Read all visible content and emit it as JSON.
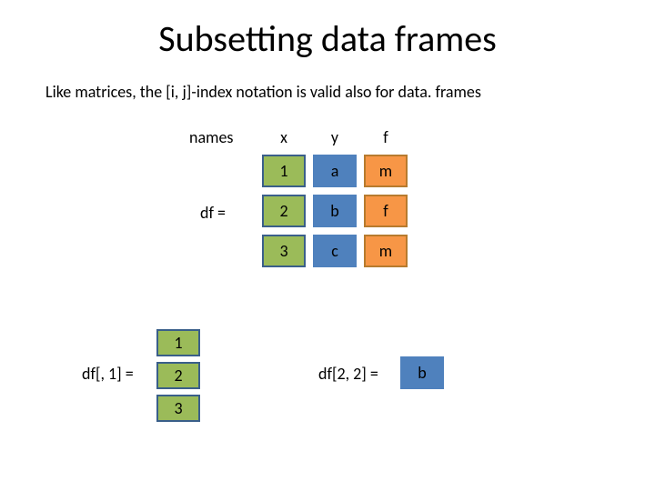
{
  "title": "Subsetting data frames",
  "subtitle": "Like matrices, the [i, j]-index notation is valid also for data. frames",
  "labels": {
    "names": "names",
    "df_eq": "df =",
    "df_col1_eq": "df[, 1] =",
    "df_22_eq": "df[2, 2] ="
  },
  "headers": {
    "x": "x",
    "y": "y",
    "f": "f"
  },
  "df": {
    "r1": {
      "x": "1",
      "y": "a",
      "f": "m"
    },
    "r2": {
      "x": "2",
      "y": "b",
      "f": "f"
    },
    "r3": {
      "x": "3",
      "y": "c",
      "f": "m"
    }
  },
  "col1": {
    "v1": "1",
    "v2": "2",
    "v3": "3"
  },
  "result_22": "b"
}
